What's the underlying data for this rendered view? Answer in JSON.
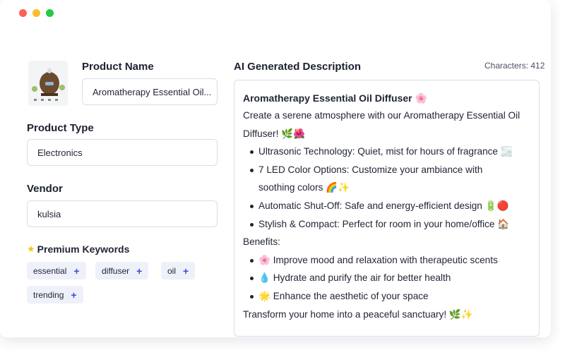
{
  "window": {
    "controls": [
      "close",
      "minimize",
      "maximize"
    ]
  },
  "product": {
    "name_label": "Product Name",
    "name_value": "Aromatherapy Essential Oil...",
    "type_label": "Product Type",
    "type_value": "Electronics",
    "vendor_label": "Vendor",
    "vendor_value": "kulsia",
    "image_icon": "diffuser-product-image"
  },
  "keywords": {
    "title": "Premium Keywords",
    "title_icon": "star-icon",
    "items": [
      {
        "label": "essential",
        "action": "+"
      },
      {
        "label": "diffuser",
        "action": "+"
      },
      {
        "label": "oil",
        "action": "+"
      },
      {
        "label": "trending",
        "action": "+"
      }
    ]
  },
  "description": {
    "label": "AI Generated Description",
    "characters": "Characters: 412",
    "title": "Aromatherapy Essential Oil Diffuser 🌸",
    "intro_1": "Create a serene atmosphere with our Aromatherapy Essential Oil",
    "intro_2": "Diffuser! 🌿🌺",
    "features": [
      "Ultrasonic Technology: Quiet, mist for hours of fragrance 🌫️",
      "7 LED Color Options: Customize your ambiance with",
      "Automatic Shut-Off: Safe and energy-efficient design 🔋🔴",
      "Stylish & Compact: Perfect for room in your home/office 🏠"
    ],
    "feature_2_cont": "soothing colors 🌈✨",
    "benefits_label": "Benefits:",
    "benefits": [
      "🌸 Improve mood and relaxation with therapeutic scents",
      "💧 Hydrate and purify the air for better health",
      "🌟 Enhance the aesthetic of your space"
    ],
    "closing": "Transform your home into a peaceful sanctuary! 🌿✨"
  },
  "colors": {
    "accent": "#3b4fd6",
    "chip_bg": "#eef1fa",
    "border": "#d9dde6"
  }
}
